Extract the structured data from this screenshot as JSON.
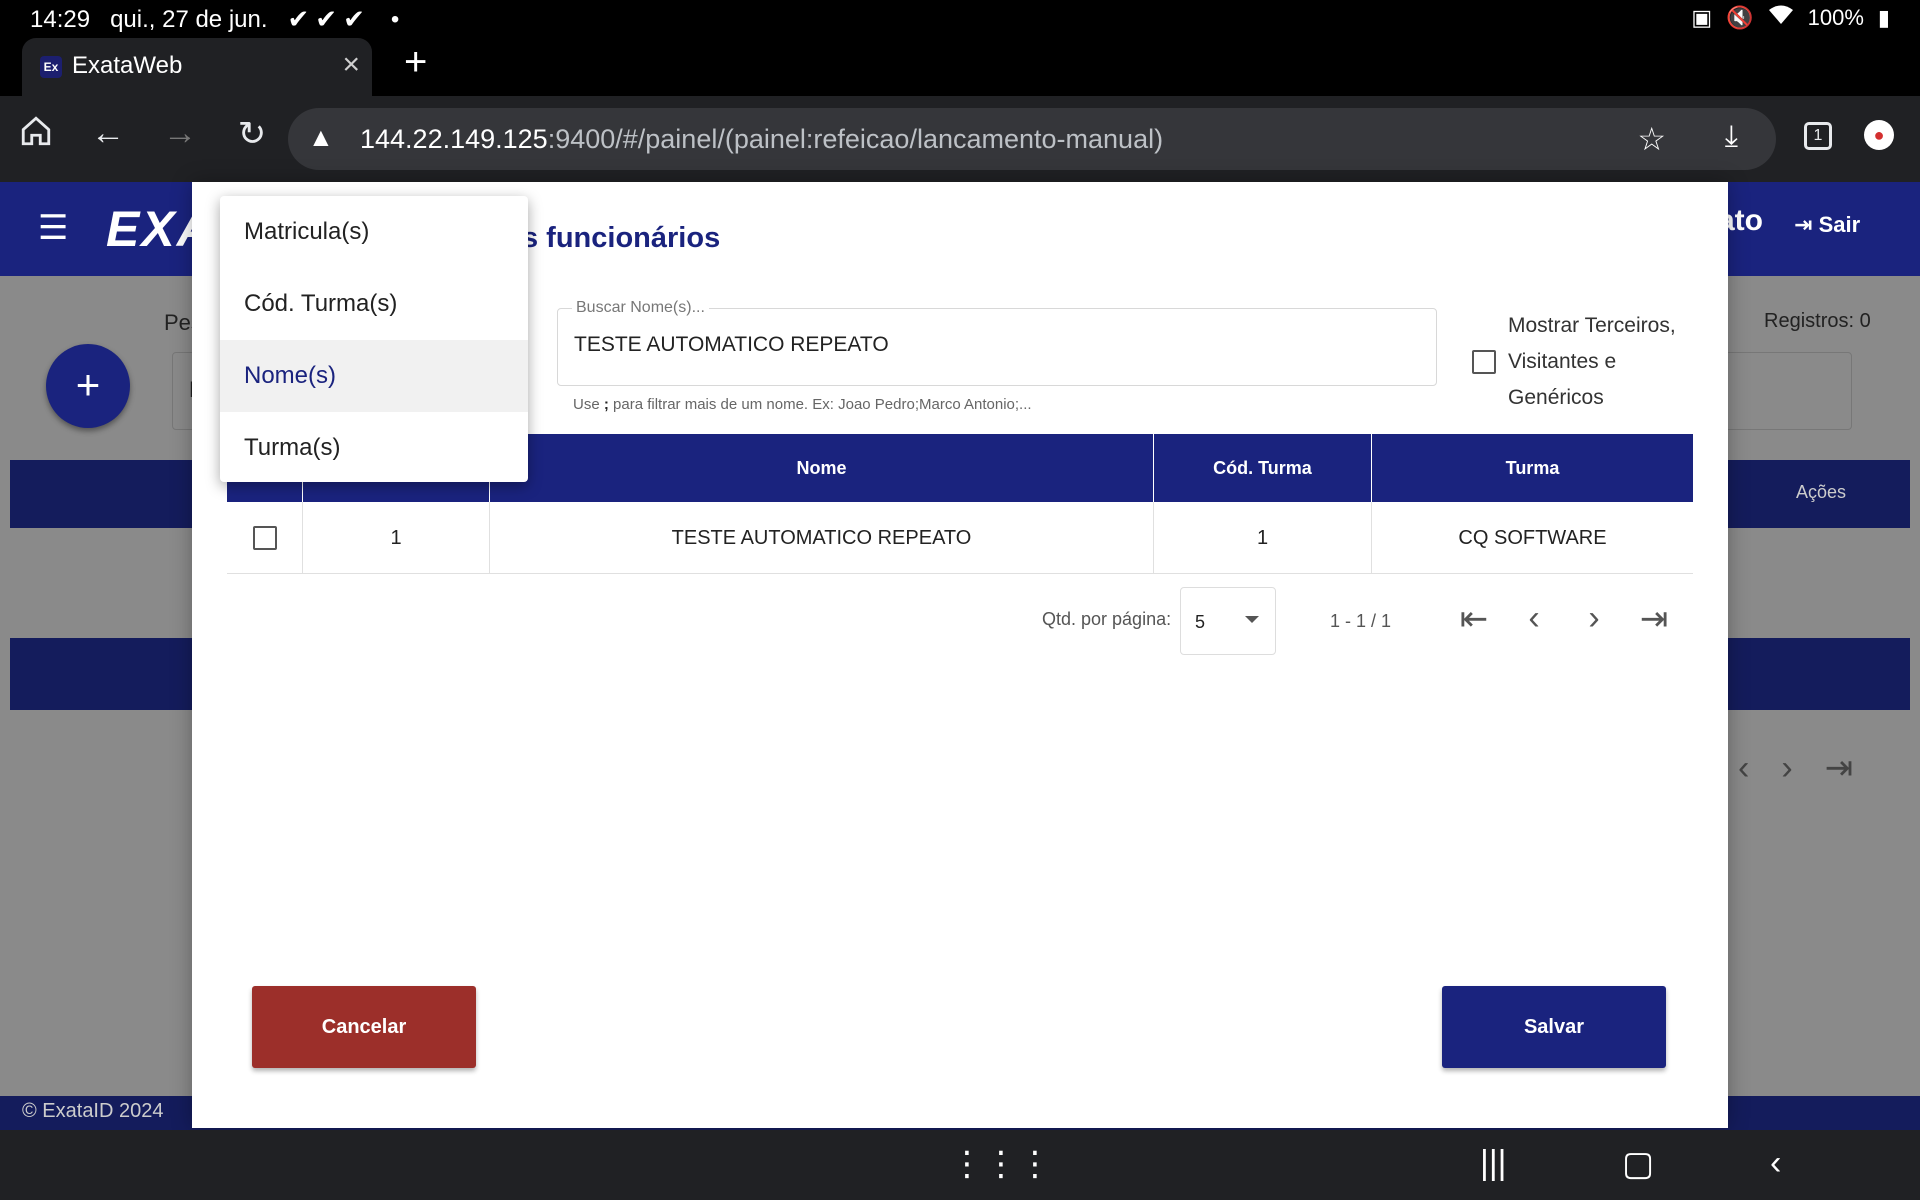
{
  "status_bar": {
    "time": "14:29",
    "date": "qui., 27 de jun.",
    "notif_icons": "✔✔✔",
    "dot": "•",
    "battery": "100%"
  },
  "browser": {
    "tab_title": "ExataWeb",
    "favicon_text": "Ex",
    "url_host": "144.22.149.125",
    "url_rest": ":9400/#/painel/(painel:refeicao/lancamento-manual)",
    "tab_count": "1"
  },
  "app": {
    "logo": "EXA",
    "user_partial": "ato",
    "logout_label": "Sair",
    "search_label_partial": "Pes",
    "search_value_partial": "N",
    "registros": "Registros: 0",
    "acoes_header": "Ações",
    "footer": "© ExataID 2024"
  },
  "modal": {
    "title_partial": "s funcionários",
    "search_field": {
      "label": "Buscar Nome(s)...",
      "value": "TESTE AUTOMATICO REPEATO"
    },
    "hint_prefix": "Use",
    "hint_sep": ";",
    "hint_suffix": "para filtrar mais de um nome. Ex: Joao Pedro;Marco Antonio;...",
    "show_third_parties_label": "Mostrar Terceiros, Visitantes e Genéricos",
    "table": {
      "headers": [
        "",
        "",
        "Nome",
        "Cód. Turma",
        "Turma"
      ],
      "rows": [
        {
          "matricula": "1",
          "nome": "TESTE AUTOMATICO REPEATO",
          "cod_turma": "1",
          "turma": "CQ SOFTWARE"
        }
      ]
    },
    "pagination": {
      "per_page_label": "Qtd. por página:",
      "per_page_value": "5",
      "range": "1 - 1 / 1"
    },
    "cancel_label": "Cancelar",
    "save_label": "Salvar"
  },
  "filter_menu": {
    "items": [
      {
        "label": "Matricula(s)"
      },
      {
        "label": "Cód. Turma(s)"
      },
      {
        "label": "Nome(s)"
      },
      {
        "label": "Turma(s)"
      }
    ],
    "selected": "Nome(s)"
  },
  "colors": {
    "primary": "#1a237e",
    "cancel": "#9c2f2a"
  }
}
